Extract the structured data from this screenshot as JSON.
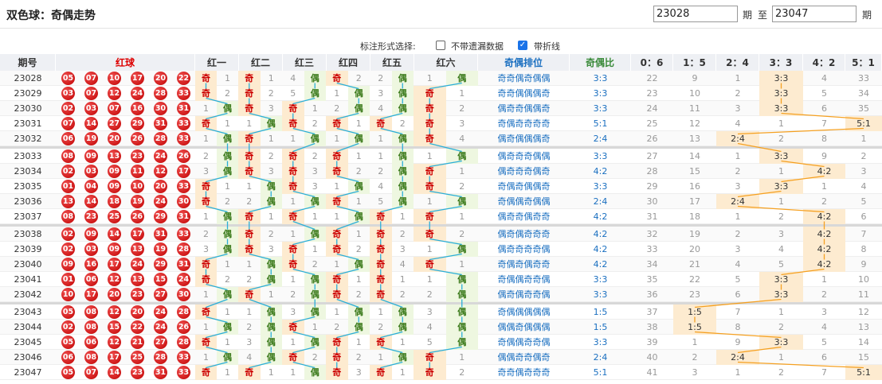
{
  "page_title": "双色球：奇偶走势",
  "range": {
    "from": "23028",
    "to": "23047",
    "period_label": "期",
    "to_label": "至"
  },
  "options": {
    "label": "标注形式选择:",
    "no_missing_label": "不带遗漏数据",
    "line_label": "带折线"
  },
  "headers": [
    "期号",
    "红球",
    "红一",
    "红二",
    "红三",
    "红四",
    "红五",
    "红六",
    "奇偶排位",
    "奇偶比",
    "0：6",
    "1：5",
    "2：4",
    "3：3",
    "4：2",
    "5：1"
  ],
  "odd_char": "奇",
  "even_char": "偶",
  "rows": [
    {
      "issue": "23028",
      "balls": [
        "05",
        "07",
        "10",
        "17",
        "20",
        "22"
      ],
      "pos": [
        [
          "O",
          ""
        ],
        [
          "O",
          ""
        ],
        [
          "",
          "4"
        ],
        [
          "O",
          ""
        ],
        [
          "",
          "2"
        ],
        [
          "",
          "1"
        ]
      ],
      "posn": [
        [
          null,
          "1"
        ],
        [
          null,
          "1"
        ],
        [
          "4",
          null
        ],
        [
          null,
          "2"
        ],
        [
          "2",
          null
        ],
        [
          "1",
          null
        ]
      ],
      "seq": "奇奇偶奇偶偶",
      "ratio": "3:3",
      "dist": [
        "22",
        "9",
        "1",
        "3:3",
        "4",
        "33"
      ]
    },
    {
      "issue": "23029",
      "balls": [
        "03",
        "07",
        "12",
        "24",
        "28",
        "33"
      ],
      "pos": "",
      "seq": "奇奇偶偶偶奇",
      "ratio": "3:3",
      "dist": [
        "23",
        "10",
        "2",
        "3:3",
        "5",
        "34"
      ]
    },
    {
      "issue": "23030",
      "balls": [
        "02",
        "03",
        "07",
        "16",
        "30",
        "31"
      ],
      "seq": "偶奇奇偶偶奇",
      "ratio": "3:3",
      "dist": [
        "24",
        "11",
        "3",
        "3:3",
        "6",
        "35"
      ]
    },
    {
      "issue": "23031",
      "balls": [
        "07",
        "14",
        "27",
        "29",
        "31",
        "33"
      ],
      "seq": "奇偶奇奇奇奇",
      "ratio": "5:1",
      "dist": [
        "25",
        "12",
        "4",
        "1",
        "7",
        "5:1"
      ]
    },
    {
      "issue": "23032",
      "balls": [
        "06",
        "19",
        "20",
        "26",
        "28",
        "33"
      ],
      "seq": "偶奇偶偶偶奇",
      "ratio": "2:4",
      "dist": [
        "26",
        "13",
        "2:4",
        "2",
        "8",
        "1"
      ]
    },
    {
      "issue": "23033",
      "balls": [
        "08",
        "09",
        "13",
        "23",
        "24",
        "26"
      ],
      "seq": "偶奇奇奇偶偶",
      "ratio": "3:3",
      "dist": [
        "27",
        "14",
        "1",
        "3:3",
        "9",
        "2"
      ]
    },
    {
      "issue": "23034",
      "balls": [
        "02",
        "03",
        "09",
        "11",
        "12",
        "17"
      ],
      "seq": "偶奇奇奇偶奇",
      "ratio": "4:2",
      "dist": [
        "28",
        "15",
        "2",
        "1",
        "4:2",
        "3"
      ]
    },
    {
      "issue": "23035",
      "balls": [
        "01",
        "04",
        "09",
        "10",
        "20",
        "33"
      ],
      "seq": "奇偶奇偶偶奇",
      "ratio": "3:3",
      "dist": [
        "29",
        "16",
        "3",
        "3:3",
        "1",
        "4"
      ]
    },
    {
      "issue": "23036",
      "balls": [
        "13",
        "14",
        "18",
        "19",
        "24",
        "30"
      ],
      "seq": "奇偶偶奇偶偶",
      "ratio": "2:4",
      "dist": [
        "30",
        "17",
        "2:4",
        "1",
        "2",
        "5"
      ]
    },
    {
      "issue": "23037",
      "balls": [
        "08",
        "23",
        "25",
        "26",
        "29",
        "31"
      ],
      "seq": "偶奇奇偶奇奇",
      "ratio": "4:2",
      "dist": [
        "31",
        "18",
        "1",
        "2",
        "4:2",
        "6"
      ]
    },
    {
      "issue": "23038",
      "balls": [
        "02",
        "09",
        "14",
        "17",
        "31",
        "33"
      ],
      "seq": "偶奇偶奇奇奇",
      "ratio": "4:2",
      "dist": [
        "32",
        "19",
        "2",
        "3",
        "4:2",
        "7"
      ]
    },
    {
      "issue": "23039",
      "balls": [
        "02",
        "03",
        "09",
        "13",
        "19",
        "28"
      ],
      "seq": "偶奇奇奇奇偶",
      "ratio": "4:2",
      "dist": [
        "33",
        "20",
        "3",
        "4",
        "4:2",
        "8"
      ]
    },
    {
      "issue": "23040",
      "balls": [
        "09",
        "16",
        "17",
        "24",
        "29",
        "31"
      ],
      "seq": "奇偶奇偶奇奇",
      "ratio": "4:2",
      "dist": [
        "34",
        "21",
        "4",
        "5",
        "4:2",
        "9"
      ]
    },
    {
      "issue": "23041",
      "balls": [
        "01",
        "06",
        "12",
        "13",
        "15",
        "24"
      ],
      "seq": "奇偶偶奇奇偶",
      "ratio": "3:3",
      "dist": [
        "35",
        "22",
        "5",
        "3:3",
        "1",
        "10"
      ]
    },
    {
      "issue": "23042",
      "balls": [
        "10",
        "17",
        "20",
        "23",
        "27",
        "30"
      ],
      "seq": "偶奇偶奇奇偶",
      "ratio": "3:3",
      "dist": [
        "36",
        "23",
        "6",
        "3:3",
        "2",
        "11"
      ]
    },
    {
      "issue": "23043",
      "balls": [
        "05",
        "08",
        "12",
        "20",
        "24",
        "28"
      ],
      "seq": "奇偶偶偶偶偶",
      "ratio": "1:5",
      "dist": [
        "37",
        "1:5",
        "7",
        "1",
        "3",
        "12"
      ]
    },
    {
      "issue": "23044",
      "balls": [
        "02",
        "08",
        "15",
        "22",
        "24",
        "26"
      ],
      "seq": "偶偶奇偶偶偶",
      "ratio": "1:5",
      "dist": [
        "38",
        "1:5",
        "8",
        "2",
        "4",
        "13"
      ]
    },
    {
      "issue": "23045",
      "balls": [
        "05",
        "06",
        "12",
        "21",
        "27",
        "28"
      ],
      "seq": "奇偶偶奇奇偶",
      "ratio": "3:3",
      "dist": [
        "39",
        "1",
        "9",
        "3:3",
        "5",
        "14"
      ]
    },
    {
      "issue": "23046",
      "balls": [
        "06",
        "08",
        "17",
        "25",
        "28",
        "33"
      ],
      "seq": "偶偶奇奇偶奇",
      "ratio": "2:4",
      "dist": [
        "40",
        "2",
        "2:4",
        "1",
        "6",
        "15"
      ]
    },
    {
      "issue": "23047",
      "balls": [
        "05",
        "07",
        "14",
        "23",
        "31",
        "33"
      ],
      "seq": "奇奇偶奇奇奇",
      "ratio": "5:1",
      "dist": [
        "41",
        "3",
        "1",
        "2",
        "7",
        "5:1"
      ]
    }
  ],
  "miss_odd": [
    [
      [
        "O",
        "1"
      ],
      [
        "O",
        "1"
      ],
      [
        "4",
        "E"
      ],
      [
        "O",
        "2"
      ],
      [
        "2",
        "E"
      ],
      [
        "1",
        "E"
      ]
    ],
    [
      [
        "O",
        "2"
      ],
      [
        "O",
        "2"
      ],
      [
        "5",
        "E"
      ],
      [
        "1",
        "E"
      ],
      [
        "3",
        "E"
      ],
      [
        "O",
        "1"
      ]
    ],
    [
      [
        "1",
        "E"
      ],
      [
        "O",
        "3"
      ],
      [
        "O",
        "1"
      ],
      [
        "2",
        "E"
      ],
      [
        "4",
        "E"
      ],
      [
        "O",
        "2"
      ]
    ],
    [
      [
        "O",
        "1"
      ],
      [
        "1",
        "E"
      ],
      [
        "O",
        "2"
      ],
      [
        "O",
        "1"
      ],
      [
        "O",
        "2"
      ],
      [
        "O",
        "3"
      ]
    ],
    [
      [
        "1",
        "E"
      ],
      [
        "O",
        "1"
      ],
      [
        "1",
        "E"
      ],
      [
        "1",
        "E"
      ],
      [
        "1",
        "E"
      ],
      [
        "O",
        "4"
      ]
    ],
    [
      [
        "2",
        "E"
      ],
      [
        "O",
        "2"
      ],
      [
        "O",
        "2"
      ],
      [
        "O",
        "1"
      ],
      [
        "1",
        "E"
      ],
      [
        "1",
        "E"
      ]
    ],
    [
      [
        "3",
        "E"
      ],
      [
        "O",
        "3"
      ],
      [
        "O",
        "3"
      ],
      [
        "O",
        "2"
      ],
      [
        "2",
        "E"
      ],
      [
        "O",
        "1"
      ]
    ],
    [
      [
        "O",
        "1"
      ],
      [
        "1",
        "E"
      ],
      [
        "O",
        "3"
      ],
      [
        "1",
        "E"
      ],
      [
        "4",
        "E"
      ],
      [
        "O",
        "2"
      ]
    ],
    [
      [
        "O",
        "2"
      ],
      [
        "2",
        "E"
      ],
      [
        "1",
        "E"
      ],
      [
        "O",
        "1"
      ],
      [
        "5",
        "E"
      ],
      [
        "1",
        "E"
      ]
    ],
    [
      [
        "1",
        "E"
      ],
      [
        "O",
        "1"
      ],
      [
        "O",
        "1"
      ],
      [
        "1",
        "E"
      ],
      [
        "O",
        "1"
      ],
      [
        "O",
        "1"
      ]
    ],
    [
      [
        "2",
        "E"
      ],
      [
        "O",
        "2"
      ],
      [
        "1",
        "E"
      ],
      [
        "O",
        "1"
      ],
      [
        "O",
        "2"
      ],
      [
        "O",
        "2"
      ]
    ],
    [
      [
        "3",
        "E"
      ],
      [
        "O",
        "3"
      ],
      [
        "O",
        "1"
      ],
      [
        "O",
        "2"
      ],
      [
        "O",
        "3"
      ],
      [
        "1",
        "E"
      ]
    ],
    [
      [
        "O",
        "1"
      ],
      [
        "1",
        "E"
      ],
      [
        "O",
        "2"
      ],
      [
        "1",
        "E"
      ],
      [
        "O",
        "4"
      ],
      [
        "O",
        "1"
      ]
    ],
    [
      [
        "O",
        "2"
      ],
      [
        "2",
        "E"
      ],
      [
        "1",
        "E"
      ],
      [
        "O",
        "1"
      ],
      [
        "O",
        "1"
      ],
      [
        "1",
        "E"
      ]
    ],
    [
      [
        "1",
        "E"
      ],
      [
        "O",
        "1"
      ],
      [
        "2",
        "E"
      ],
      [
        "O",
        "2"
      ],
      [
        "O",
        "2"
      ],
      [
        "2",
        "E"
      ]
    ],
    [
      [
        "O",
        "1"
      ],
      [
        "1",
        "E"
      ],
      [
        "3",
        "E"
      ],
      [
        "1",
        "E"
      ],
      [
        "1",
        "E"
      ],
      [
        "3",
        "E"
      ]
    ],
    [
      [
        "1",
        "E"
      ],
      [
        "2",
        "E"
      ],
      [
        "O",
        "1"
      ],
      [
        "2",
        "E"
      ],
      [
        "2",
        "E"
      ],
      [
        "4",
        "E"
      ]
    ],
    [
      [
        "O",
        "1"
      ],
      [
        "3",
        "E"
      ],
      [
        "1",
        "E"
      ],
      [
        "O",
        "1"
      ],
      [
        "O",
        "1"
      ],
      [
        "5",
        "E"
      ]
    ],
    [
      [
        "1",
        "E"
      ],
      [
        "4",
        "E"
      ],
      [
        "O",
        "2"
      ],
      [
        "O",
        "2"
      ],
      [
        "1",
        "E"
      ],
      [
        "O",
        "1"
      ]
    ],
    [
      [
        "O",
        "1"
      ],
      [
        "O",
        "1"
      ],
      [
        "1",
        "E"
      ],
      [
        "O",
        "3"
      ],
      [
        "O",
        "1"
      ],
      [
        "O",
        "2"
      ]
    ]
  ]
}
